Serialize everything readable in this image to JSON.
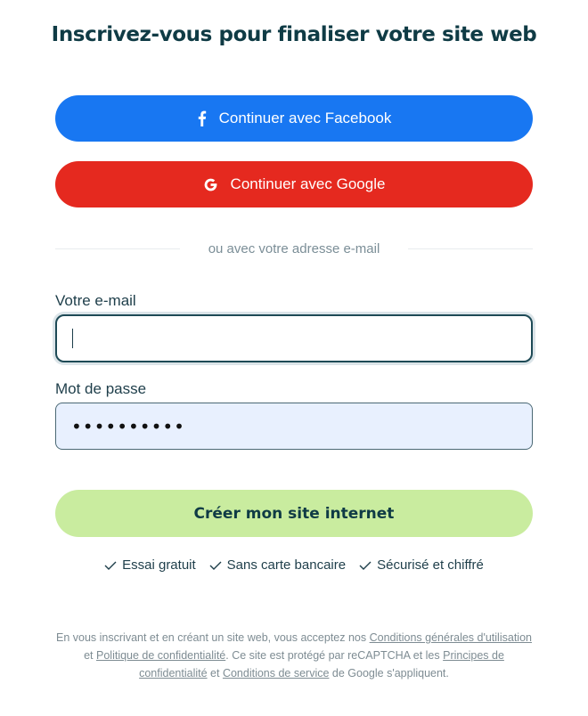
{
  "title": "Inscrivez-vous pour finaliser votre site web",
  "social": {
    "facebook_label": "Continuer avec Facebook",
    "google_label": "Continuer avec Google"
  },
  "divider_text": "ou avec votre adresse e-mail",
  "form": {
    "email_label": "Votre e-mail",
    "email_value": "",
    "password_label": "Mot de passe",
    "password_value": "••••••••••",
    "submit_label": "Créer mon site internet"
  },
  "features": [
    "Essai gratuit",
    "Sans carte bancaire",
    "Sécurisé et chiffré"
  ],
  "legal": {
    "t1": "En vous inscrivant et en créant un site web, vous acceptez nos ",
    "link1": "Conditions générales d'utilisation",
    "t2": " et ",
    "link2": "Politique de confidentialité",
    "t3": ". Ce site est protégé par reCAPTCHA et les ",
    "link3": "Principes de confidentialité",
    "t4": " et ",
    "link4": "Conditions de service",
    "t5": " de Google s'appliquent."
  },
  "colors": {
    "facebook": "#1877f2",
    "google": "#e5291f",
    "submit": "#c9ec9f",
    "title": "#0f3b45"
  },
  "icons": {
    "facebook": "facebook-icon",
    "google": "google-icon",
    "check": "check-icon"
  }
}
